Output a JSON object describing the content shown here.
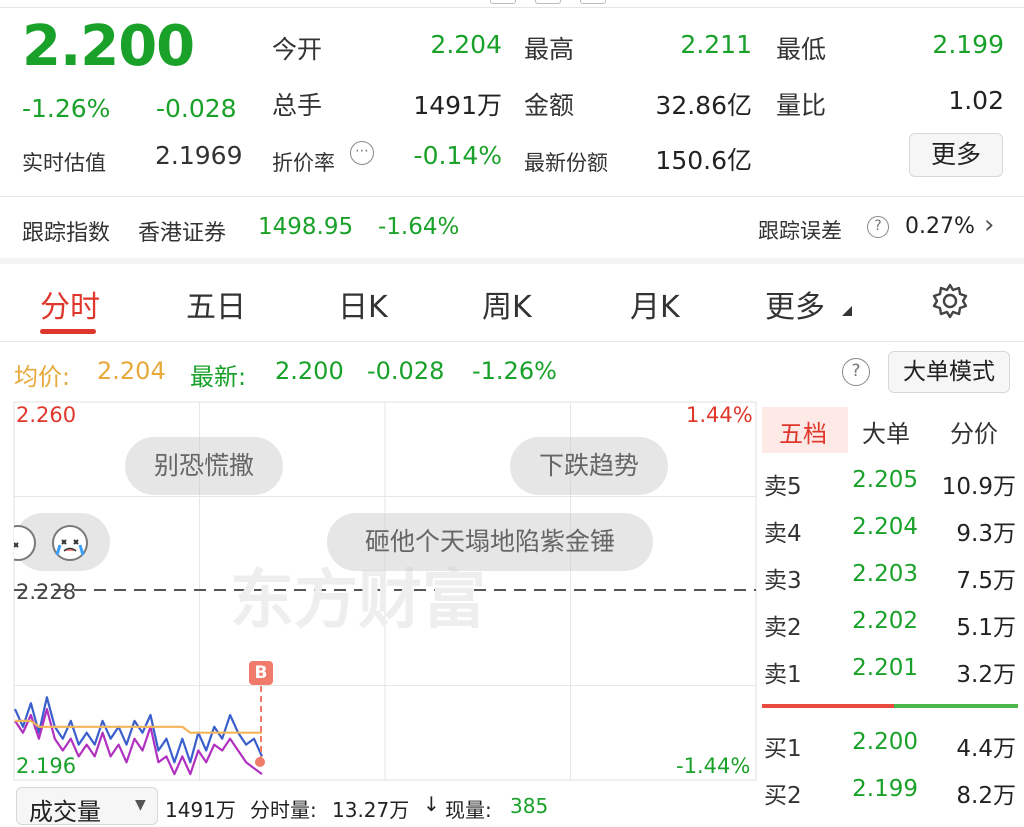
{
  "quote": {
    "last_price": "2.200",
    "change_pct": "-1.26%",
    "change": "-0.028",
    "iopv_label": "实时估值",
    "iopv_value": "2.1969",
    "open_label": "今开",
    "open_value": "2.204",
    "high_label": "最高",
    "high_value": "2.211",
    "low_label": "最低",
    "low_value": "2.199",
    "volume_label": "总手",
    "volume_value": "1491万",
    "amount_label": "金额",
    "amount_value": "32.86亿",
    "vol_ratio_label": "量比",
    "vol_ratio_value": "1.02",
    "premium_label": "折价率",
    "premium_value": "-0.14%",
    "shares_label": "最新份额",
    "shares_value": "150.6亿",
    "more_label": "更多"
  },
  "tracking": {
    "index_label": "跟踪指数",
    "index_name": "香港证券",
    "index_value": "1498.95",
    "index_change": "-1.64%",
    "error_label": "跟踪误差",
    "error_value": "0.27%"
  },
  "tabs": [
    "分时",
    "五日",
    "日K",
    "周K",
    "月K",
    "更多"
  ],
  "intraday": {
    "avg_label": "均价:",
    "avg_value": "2.204",
    "latest_label": "最新:",
    "latest_value": "2.200",
    "latest_change": "-0.028",
    "latest_pct": "-1.26%",
    "mode_button": "大单模式"
  },
  "chart": {
    "y_top": "2.260",
    "y_mid": "2.228",
    "y_bottom": "2.196",
    "pct_top": "1.44%",
    "pct_bottom": "-1.44%",
    "marker": "B",
    "watermark": "东方财富",
    "comments": [
      "别恐慌撒",
      "下跌趋势",
      "砸他个天塌地陷紫金锤"
    ]
  },
  "chart_data": {
    "type": "line",
    "ylim": [
      2.196,
      2.26
    ],
    "reference": 2.228,
    "series": [
      {
        "values": [
          2.208,
          2.205,
          2.209,
          2.204,
          2.21,
          2.205,
          2.203,
          2.206,
          2.202,
          2.204,
          2.202,
          2.206,
          2.203,
          2.205,
          2.202,
          2.206,
          2.204,
          2.207,
          2.201,
          2.203,
          2.199,
          2.203,
          2.199,
          2.204,
          2.201,
          2.205,
          2.203,
          2.207,
          2.204,
          2.202,
          2.203,
          2.2
        ]
      },
      {
        "values": [
          2.206,
          2.204,
          2.207,
          2.203,
          2.208,
          2.203,
          2.201,
          2.203,
          2.2,
          2.202,
          2.2,
          2.204,
          2.2,
          2.202,
          2.199,
          2.203,
          2.201,
          2.205,
          2.199,
          2.2,
          2.197,
          2.2,
          2.197,
          2.201,
          2.199,
          2.202,
          2.201,
          2.203,
          2.201,
          2.199,
          2.198,
          2.197
        ]
      },
      {
        "values": [
          2.206,
          2.206,
          2.206,
          2.205,
          2.205,
          2.205,
          2.205,
          2.205,
          2.205,
          2.205,
          2.205,
          2.205,
          2.205,
          2.205,
          2.205,
          2.205,
          2.205,
          2.205,
          2.205,
          2.205,
          2.205,
          2.205,
          2.204,
          2.204,
          2.204,
          2.204,
          2.204,
          2.204,
          2.204,
          2.204,
          2.204,
          2.204
        ]
      }
    ],
    "colors": {
      "price": "#3a5fcd",
      "secondary": "#b030c0",
      "avg": "#f2b55a"
    }
  },
  "orderbook": {
    "tabs": [
      "五档",
      "大单",
      "分价"
    ],
    "asks": [
      {
        "label": "卖5",
        "price": "2.205",
        "vol": "10.9万"
      },
      {
        "label": "卖4",
        "price": "2.204",
        "vol": "9.3万"
      },
      {
        "label": "卖3",
        "price": "2.203",
        "vol": "7.5万"
      },
      {
        "label": "卖2",
        "price": "2.202",
        "vol": "5.1万"
      },
      {
        "label": "卖1",
        "price": "2.201",
        "vol": "3.2万"
      }
    ],
    "bids": [
      {
        "label": "买1",
        "price": "2.200",
        "vol": "4.4万"
      },
      {
        "label": "买2",
        "price": "2.199",
        "vol": "8.2万"
      }
    ]
  },
  "footer": {
    "selector": "成交量",
    "volume": "1491万",
    "minute_label": "分时量:",
    "minute_value": "13.27万",
    "current_label": "现量:",
    "current_value": "385"
  },
  "colors": {
    "up": "#e0372c",
    "down": "#1aa12a",
    "avg": "#e8a93c"
  }
}
